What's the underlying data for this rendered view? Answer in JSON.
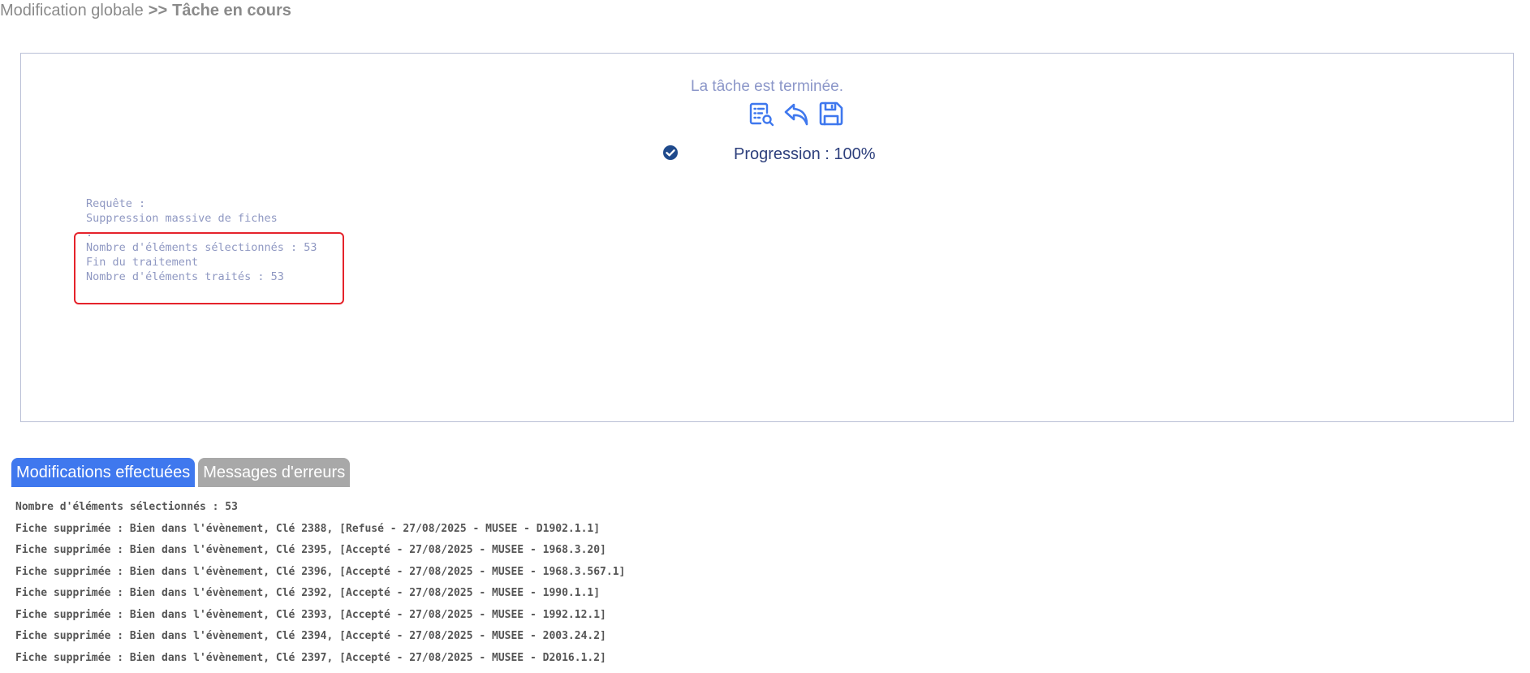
{
  "breadcrumb": {
    "parent": "Modification globale",
    "separator": ">>",
    "current": "Tâche en cours"
  },
  "task": {
    "status_text": "La tâche est terminée.",
    "icons": [
      "report-view-icon",
      "undo-arrow-icon",
      "save-floppy-icon"
    ],
    "progress_value": 100,
    "progress_label": "Progression : 100%",
    "accent_color": "#3f78ee"
  },
  "log": {
    "lines": [
      "Requête :",
      "Suppression massive de fiches",
      ".",
      "Nombre d'éléments sélectionnés : 53",
      "Fin du traitement",
      "Nombre d'éléments traités : 53"
    ]
  },
  "tabs": [
    {
      "label": "Modifications effectuées",
      "active": true
    },
    {
      "label": "Messages d'erreurs",
      "active": false
    }
  ],
  "results": {
    "lines": [
      "Nombre d'éléments sélectionnés : 53",
      "Fiche supprimée : Bien dans l'évènement, Clé 2388, [Refusé - 27/08/2025 - MUSEE - D1902.1.1]",
      "Fiche supprimée : Bien dans l'évènement, Clé 2395, [Accepté - 27/08/2025 - MUSEE - 1968.3.20]",
      "Fiche supprimée : Bien dans l'évènement, Clé 2396, [Accepté - 27/08/2025 - MUSEE - 1968.3.567.1]",
      "Fiche supprimée : Bien dans l'évènement, Clé 2392, [Accepté - 27/08/2025 - MUSEE - 1990.1.1]",
      "Fiche supprimée : Bien dans l'évènement, Clé 2393, [Accepté - 27/08/2025 - MUSEE - 1992.12.1]",
      "Fiche supprimée : Bien dans l'évènement, Clé 2394, [Accepté - 27/08/2025 - MUSEE - 2003.24.2]",
      "Fiche supprimée : Bien dans l'évènement, Clé 2397, [Accepté - 27/08/2025 - MUSEE - D2016.1.2]"
    ]
  }
}
